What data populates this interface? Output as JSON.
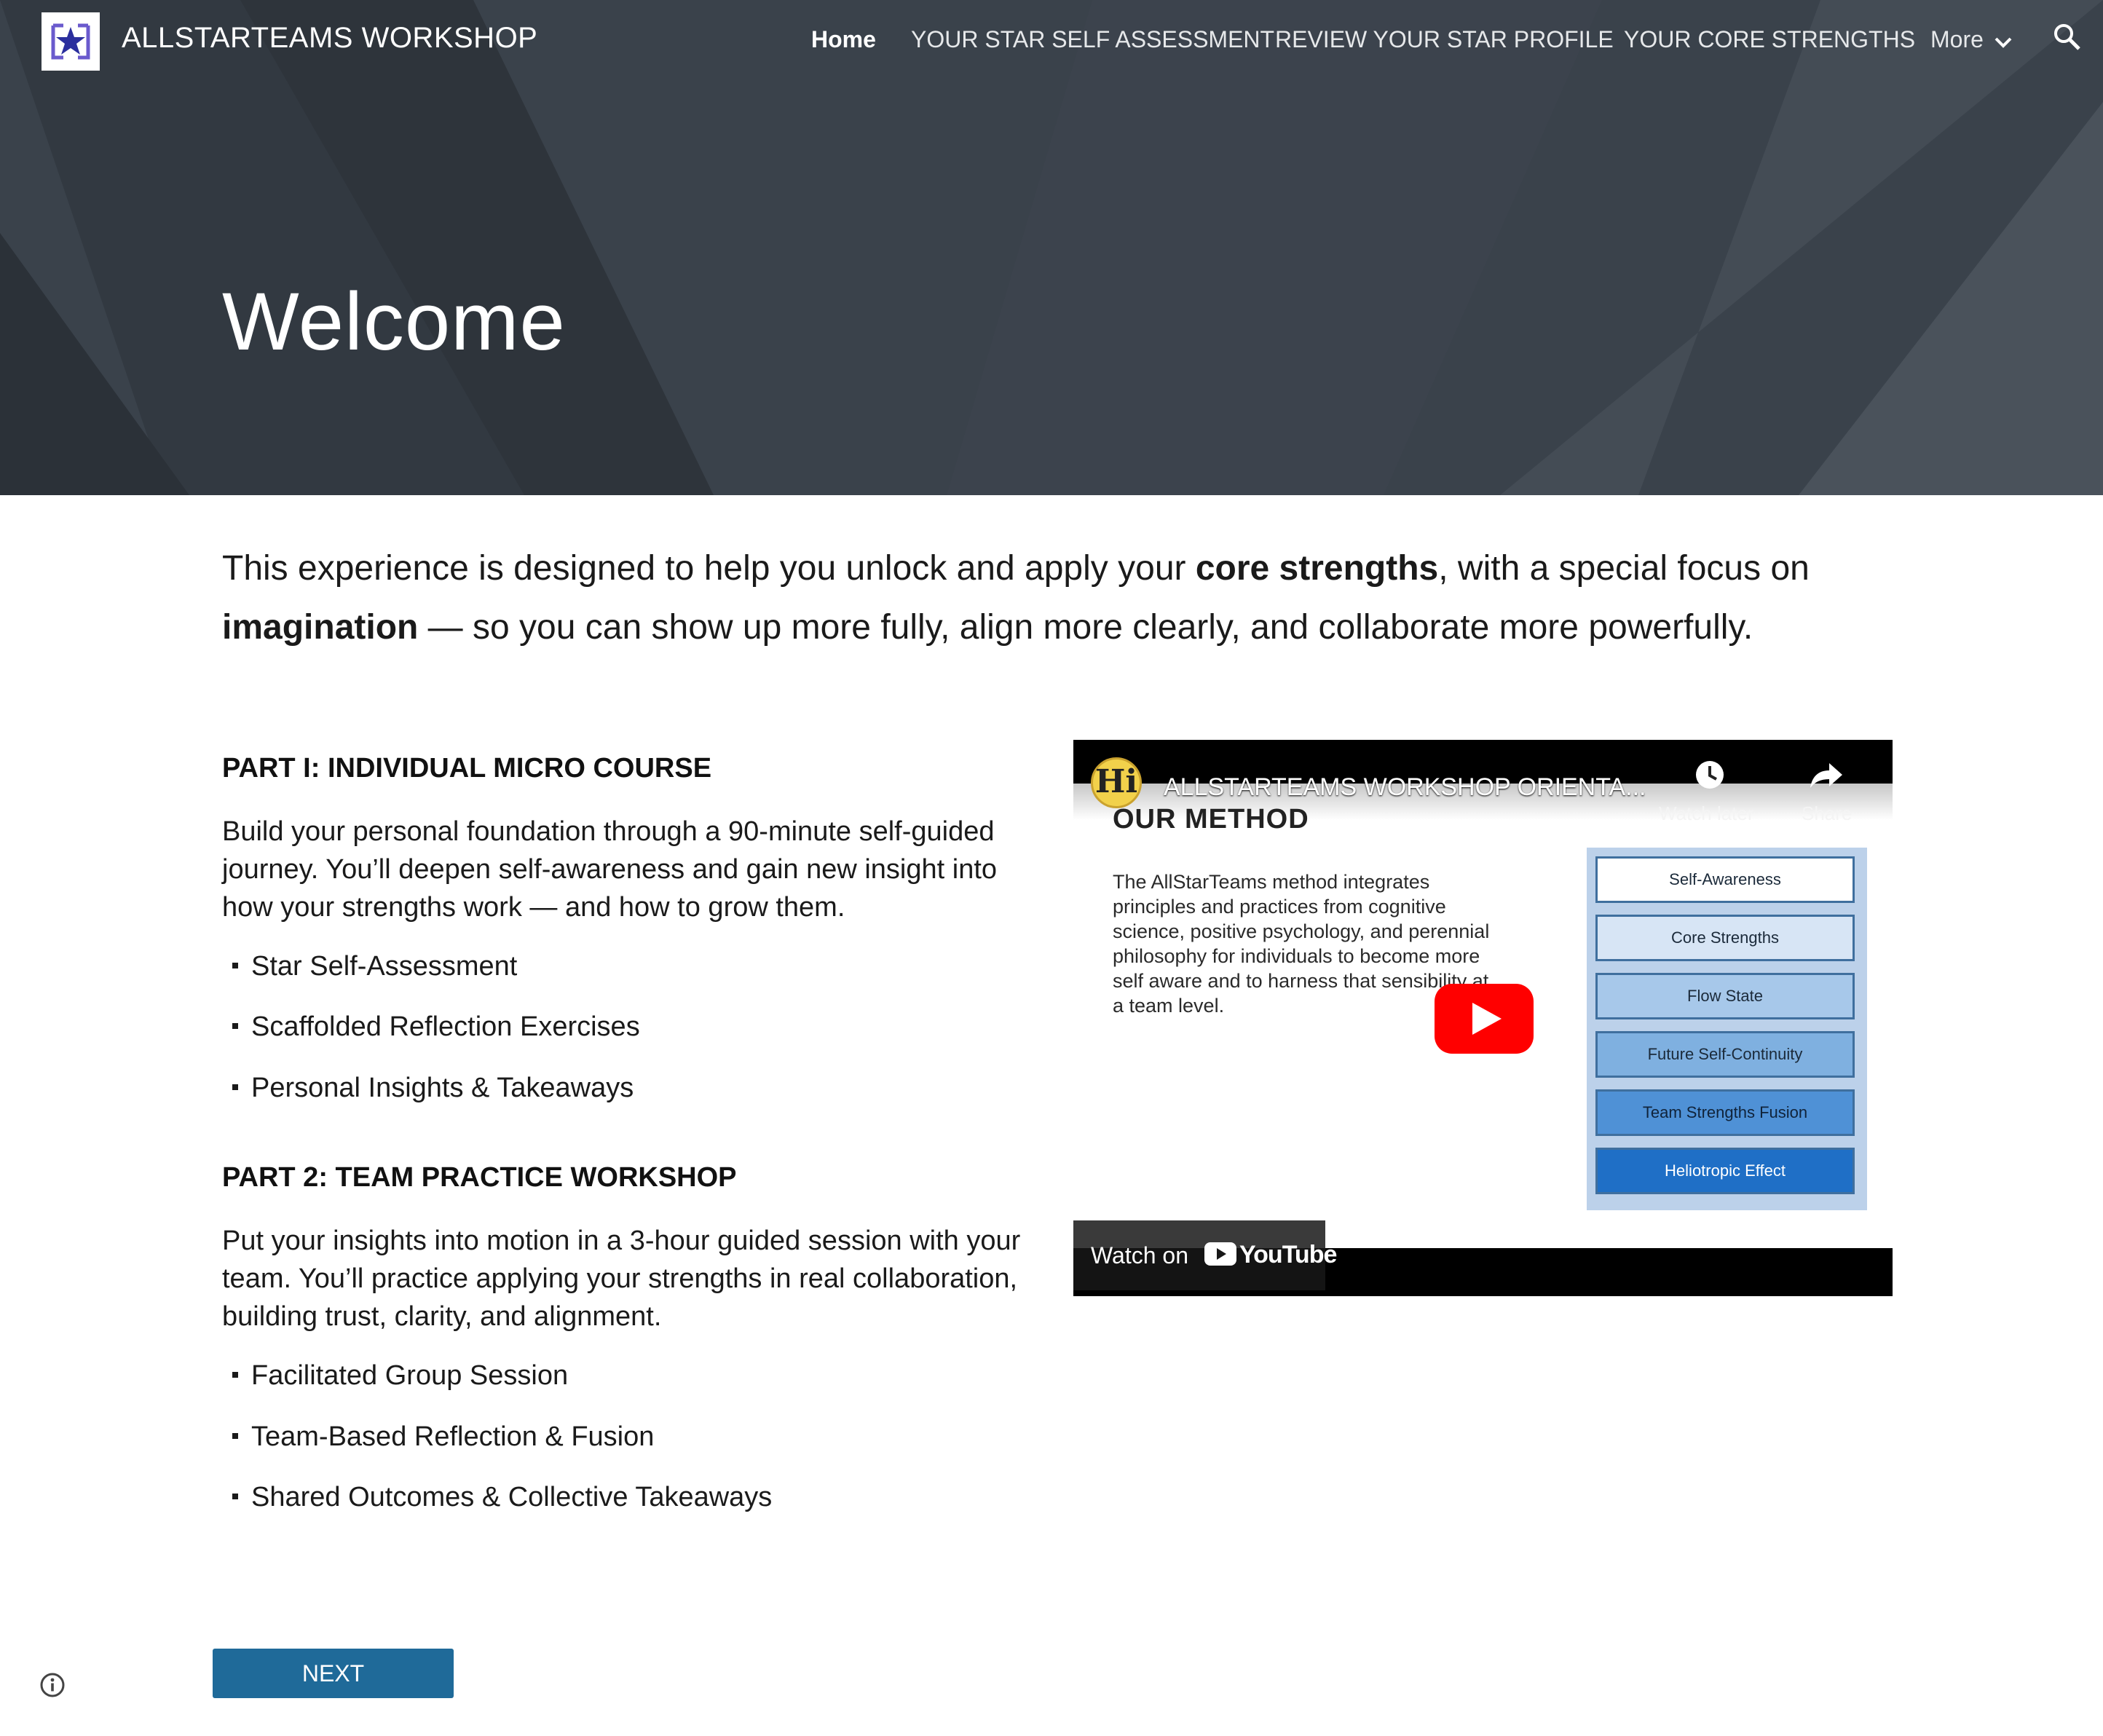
{
  "site": {
    "title": "ALLSTARTEAMS WORKSHOP"
  },
  "nav": {
    "items": [
      "Home",
      "YOUR STAR SELF ASSESSMENT",
      "REVIEW YOUR STAR PROFILE",
      "YOUR CORE STRENGTHS",
      "More"
    ],
    "active": "Home"
  },
  "hero": {
    "title": "Welcome"
  },
  "intro": {
    "part1": "This experience is designed to help you unlock and apply your ",
    "bold1": "core strengths",
    "part2": ", with a special focus on",
    "bold2": "imagination",
    "part3": " — so you can show up more fully, align more clearly, and collaborate more powerfully."
  },
  "part1": {
    "heading": "PART I: INDIVIDUAL MICRO COURSE",
    "lines": [
      "Build your personal foundation through a 90-minute self-guided",
      "journey. You’ll deepen self-awareness and gain new insight into",
      "how your strengths work — and how to grow them."
    ],
    "bullets": [
      "Star Self-Assessment",
      "Scaffolded Reflection Exercises",
      "Personal Insights & Takeaways"
    ]
  },
  "part2": {
    "heading": "PART 2: TEAM PRACTICE WORKSHOP",
    "lines": [
      "Put your insights into motion in a 3-hour guided session with your",
      "team. You’ll practice applying your strengths in real collaboration,",
      "building trust, clarity, and alignment."
    ],
    "bullets": [
      "Facilitated Group Session",
      "Team-Based Reflection & Fusion",
      "Shared Outcomes & Collective Takeaways"
    ]
  },
  "video": {
    "badge": "Hi",
    "title": "ALLSTARTEAMS WORKSHOP ORIENTA...",
    "watch_later": "Watch later",
    "share": "Share",
    "slide_heading": "OUR METHOD",
    "slide_lines": [
      "The AllStarTeams method integrates",
      "principles and practices from cognitive",
      "science, positive psychology, and perennial",
      "philosophy  for individuals to become more",
      "self aware and to harness that sensibility at",
      "a team level."
    ],
    "method_boxes": [
      "Self-Awareness",
      "Core Strengths",
      "Flow State",
      "Future Self-Continuity",
      "Team Strengths Fusion",
      "Heliotropic Effect"
    ],
    "watch_on": "Watch on",
    "youtube": "YouTube"
  },
  "footer": {
    "next_label": "NEXT"
  },
  "colors": {
    "hero_bg": "#3a424b",
    "button": "#1f6a99",
    "play_red": "#ff0000",
    "box_fills": [
      "#ffffff",
      "#d7e5f5",
      "#a7c8ea",
      "#7fb0e0",
      "#4f91d6",
      "#1f6fc6"
    ]
  },
  "icons": [
    "logo-star-icon",
    "chevron-down-icon",
    "search-icon",
    "clock-icon",
    "share-arrow-icon",
    "play-icon",
    "youtube-icon",
    "info-icon"
  ]
}
